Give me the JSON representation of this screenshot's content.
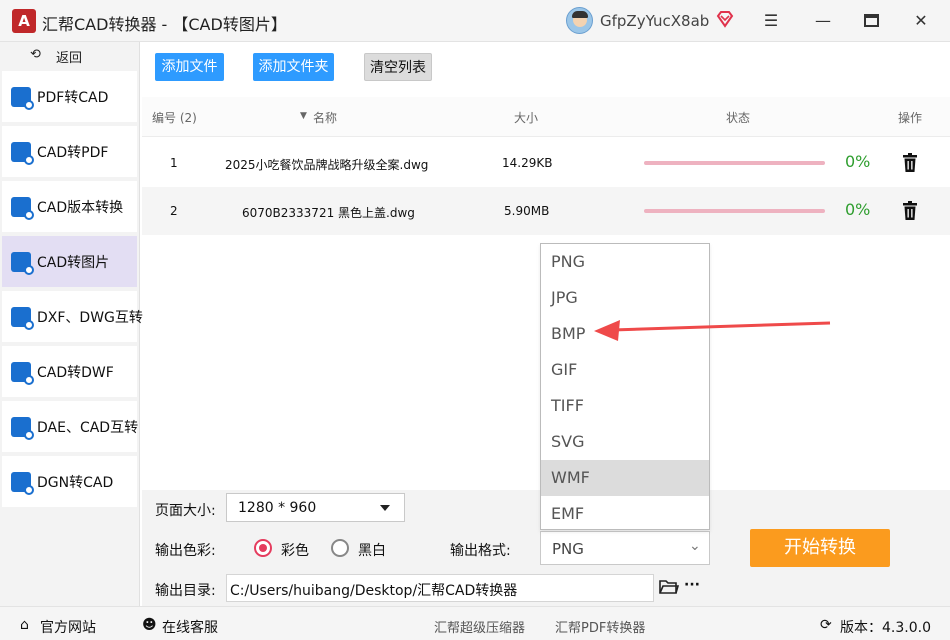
{
  "window": {
    "title": "汇帮CAD转换器 - 【CAD转图片】",
    "username": "GfpZyYucX8ab",
    "logo_text": "A"
  },
  "sidebar": {
    "back_label": "返回",
    "items": [
      {
        "label": "PDF转CAD"
      },
      {
        "label": "CAD转PDF"
      },
      {
        "label": "CAD版本转换"
      },
      {
        "label": "CAD转图片"
      },
      {
        "label": "DXF、DWG互转"
      },
      {
        "label": "CAD转DWF"
      },
      {
        "label": "DAE、CAD互转"
      },
      {
        "label": "DGN转CAD"
      }
    ],
    "active_index": 3
  },
  "toolbar": {
    "add_file": "添加文件",
    "add_folder": "添加文件夹",
    "clear_list": "清空列表"
  },
  "table": {
    "headers": {
      "index": "编号 (2)",
      "name": "名称",
      "size": "大小",
      "status": "状态",
      "action": "操作"
    },
    "rows": [
      {
        "index": "1",
        "name": "2025小吃餐饮品牌战略升级全案.dwg",
        "size": "14.29KB",
        "percent": "0%",
        "progress": 0
      },
      {
        "index": "2",
        "name": "6070B2333721 黑色上盖.dwg",
        "size": "5.90MB",
        "percent": "0%",
        "progress": 0
      }
    ]
  },
  "dropdown": {
    "options": [
      "PNG",
      "JPG",
      "BMP",
      "GIF",
      "TIFF",
      "SVG",
      "WMF",
      "EMF"
    ],
    "highlighted": "WMF"
  },
  "settings": {
    "page_size_label": "页面大小:",
    "page_size_value": "1280 * 960",
    "color_label": "输出色彩:",
    "color_option": "彩色",
    "bw_option": "黑白",
    "selected_color": "彩色",
    "format_label": "输出格式:",
    "format_value": "PNG",
    "dir_label": "输出目录:",
    "dir_value": "C:/Users/huibang/Desktop/汇帮CAD转换器",
    "more": "···",
    "start_button": "开始转换"
  },
  "statusbar": {
    "website": "官方网站",
    "support": "在线客服",
    "compressor": "汇帮超级压缩器",
    "pdf_converter": "汇帮PDF转换器",
    "version": "版本：4.3.0.0"
  },
  "colors": {
    "accent_blue": "#2e9bff",
    "start_orange": "#fb9b1e",
    "progress_pink": "#eeb2c0",
    "percent_green": "#2f9e2f",
    "annotation_red": "#ef4a4a",
    "active_nav": "#e3def3"
  }
}
